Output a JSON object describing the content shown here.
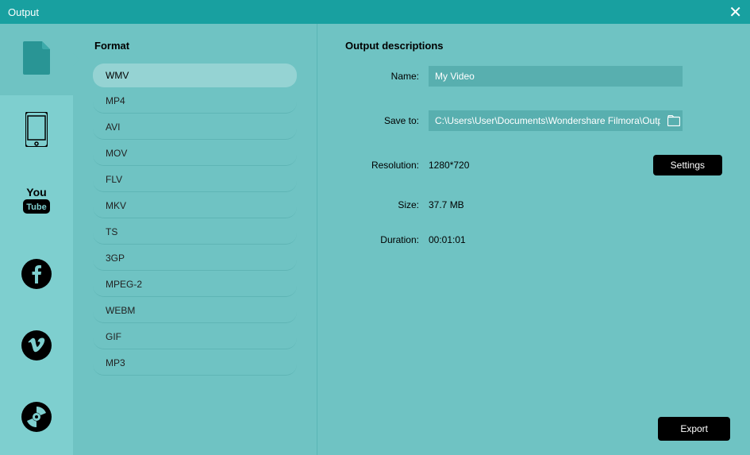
{
  "window": {
    "title": "Output"
  },
  "sidebar": {
    "items": [
      {
        "name": "document",
        "active": true
      },
      {
        "name": "device",
        "active": false
      },
      {
        "name": "youtube",
        "active": false
      },
      {
        "name": "facebook",
        "active": false
      },
      {
        "name": "vimeo",
        "active": false
      },
      {
        "name": "dvd",
        "active": false
      }
    ]
  },
  "formatPanel": {
    "heading": "Format",
    "items": [
      "WMV",
      "MP4",
      "AVI",
      "MOV",
      "FLV",
      "MKV",
      "TS",
      "3GP",
      "MPEG-2",
      "WEBM",
      "GIF",
      "MP3"
    ],
    "activeIndex": 0
  },
  "details": {
    "heading": "Output descriptions",
    "nameLabel": "Name:",
    "nameValue": "My Video",
    "saveToLabel": "Save to:",
    "saveToValue": "C:\\Users\\User\\Documents\\Wondershare Filmora\\Outp",
    "resolutionLabel": "Resolution:",
    "resolutionValue": "1280*720",
    "settingsLabel": "Settings",
    "sizeLabel": "Size:",
    "sizeValue": "37.7 MB",
    "durationLabel": "Duration:",
    "durationValue": "00:01:01",
    "exportLabel": "Export"
  }
}
